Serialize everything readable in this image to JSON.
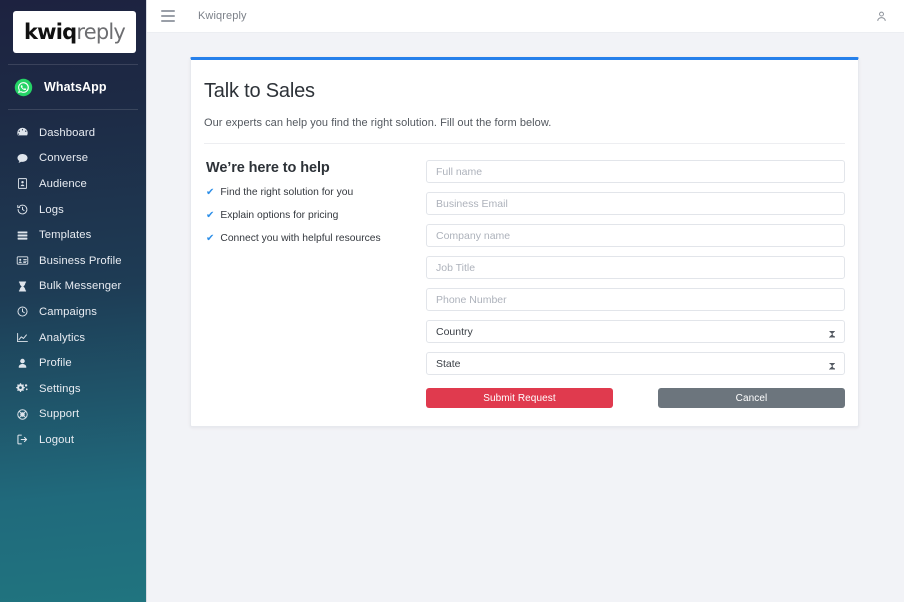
{
  "sidebar": {
    "logo": {
      "part1": "kwiq",
      "part2": "reply"
    },
    "channel": {
      "label": "WhatsApp",
      "icon": "whatsapp-icon",
      "color": "#25D366"
    },
    "items": [
      {
        "label": "Dashboard",
        "icon": "dashboard-icon"
      },
      {
        "label": "Converse",
        "icon": "chat-bubble-icon"
      },
      {
        "label": "Audience",
        "icon": "audience-card-icon"
      },
      {
        "label": "Logs",
        "icon": "history-clock-icon"
      },
      {
        "label": "Templates",
        "icon": "templates-list-icon"
      },
      {
        "label": "Business Profile",
        "icon": "id-card-icon"
      },
      {
        "label": "Bulk Messenger",
        "icon": "hourglass-icon"
      },
      {
        "label": "Campaigns",
        "icon": "clock-icon"
      },
      {
        "label": "Analytics",
        "icon": "chart-line-icon"
      },
      {
        "label": "Profile",
        "icon": "person-icon"
      },
      {
        "label": "Settings",
        "icon": "gears-icon"
      },
      {
        "label": "Support",
        "icon": "globe-support-icon"
      },
      {
        "label": "Logout",
        "icon": "logout-icon"
      }
    ]
  },
  "topbar": {
    "menu_icon": "hamburger-icon",
    "brand": "Kwiqreply",
    "user_icon": "user-account-icon"
  },
  "card": {
    "accent_color": "#2680eb",
    "title": "Talk to Sales",
    "subtitle": "Our experts can help you find the right solution. Fill out the form below.",
    "left": {
      "heading": "We’re here to help",
      "check_color": "#2e8fe8",
      "bullets": [
        "Find the right solution for you",
        "Explain options for pricing",
        "Connect you with helpful resources"
      ]
    },
    "form": {
      "fields": [
        {
          "name": "full-name",
          "placeholder": "Full name",
          "value": "",
          "type": "text"
        },
        {
          "name": "business-email",
          "placeholder": "Business Email",
          "value": "",
          "type": "text"
        },
        {
          "name": "company-name",
          "placeholder": "Company name",
          "value": "",
          "type": "text"
        },
        {
          "name": "job-title",
          "placeholder": "Job Title",
          "value": "",
          "type": "text"
        },
        {
          "name": "phone-number",
          "placeholder": "Phone Number",
          "value": "",
          "type": "text"
        }
      ],
      "selects": [
        {
          "name": "country",
          "selected": "Country"
        },
        {
          "name": "state",
          "selected": "State"
        }
      ],
      "submit_label": "Submit Request",
      "submit_color": "#e03a4e",
      "cancel_label": "Cancel",
      "cancel_color": "#6c757d"
    }
  }
}
